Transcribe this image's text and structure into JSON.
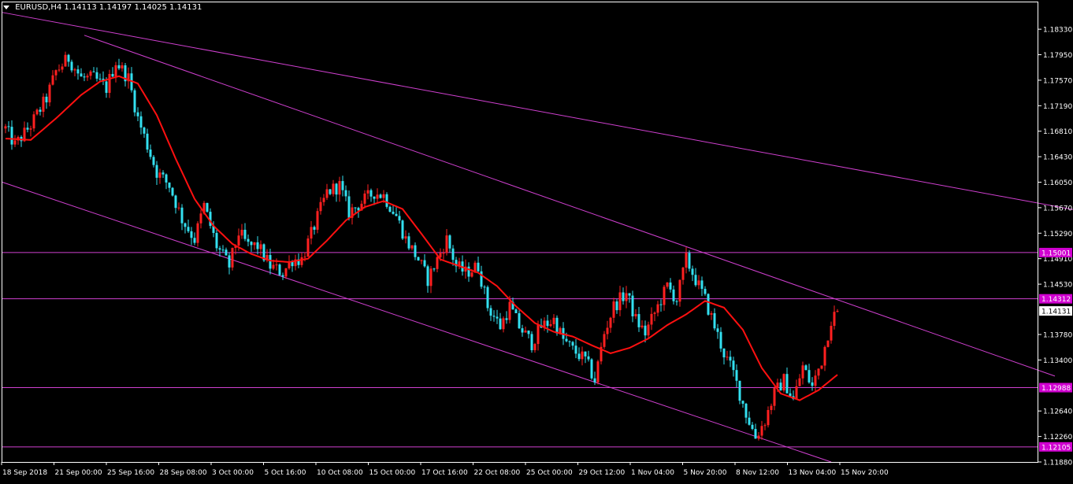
{
  "header": {
    "symbol": "EURUSD,H4",
    "ohlc": "1.14113 1.14197 1.14025 1.14131"
  },
  "colors": {
    "background": "#000000",
    "axis": "#ffffff",
    "bull_candle": "#ff2020",
    "bear_candle": "#33e0f0",
    "moving_average": "#ff1010",
    "lines": "#d040d0",
    "label_bg": "#d000d0",
    "price_label_bg": "#ffffff"
  },
  "chart_data": {
    "type": "candlestick",
    "symbol": "EURUSD",
    "timeframe": "H4",
    "ylim": [
      1.1188,
      1.1866
    ],
    "y_ticks": [
      1.1833,
      1.1795,
      1.1757,
      1.1719,
      1.1681,
      1.1643,
      1.1605,
      1.1567,
      1.1529,
      1.1491,
      1.1453,
      1.1378,
      1.134,
      1.1264,
      1.1226,
      1.1188
    ],
    "y_tick_labels": [
      "1.18330",
      "1.17950",
      "1.17570",
      "1.17190",
      "1.16810",
      "1.16430",
      "1.16050",
      "1.15670",
      "1.15290",
      "1.14910",
      "1.14530",
      "1.13780",
      "1.13400",
      "1.12640",
      "1.12260",
      "1.11880"
    ],
    "x_tick_labels": [
      "18 Sep 2018",
      "21 Sep 00:00",
      "25 Sep 16:00",
      "28 Sep 08:00",
      "3 Oct 00:00",
      "5 Oct 16:00",
      "10 Oct 08:00",
      "15 Oct 00:00",
      "17 Oct 16:00",
      "22 Oct 08:00",
      "25 Oct 00:00",
      "29 Oct 12:00",
      "1 Nov 04:00",
      "5 Nov 20:00",
      "8 Nov 12:00",
      "13 Nov 04:00",
      "15 Nov 20:00"
    ],
    "price_path": [
      [
        0,
        1.1685
      ],
      [
        3,
        1.166
      ],
      [
        8,
        1.169
      ],
      [
        13,
        1.173
      ],
      [
        16,
        1.177
      ],
      [
        20,
        1.179
      ],
      [
        24,
        1.176
      ],
      [
        28,
        1.176
      ],
      [
        32,
        1.1745
      ],
      [
        35,
        1.1785
      ],
      [
        39,
        1.176
      ],
      [
        42,
        1.17
      ],
      [
        45,
        1.166
      ],
      [
        48,
        1.162
      ],
      [
        52,
        1.16
      ],
      [
        56,
        1.155
      ],
      [
        60,
        1.152
      ],
      [
        63,
        1.157
      ],
      [
        67,
        1.151
      ],
      [
        71,
        1.148
      ],
      [
        74,
        1.153
      ],
      [
        77,
        1.151
      ],
      [
        80,
        1.151
      ],
      [
        84,
        1.148
      ],
      [
        88,
        1.147
      ],
      [
        91,
        1.149
      ],
      [
        94,
        1.149
      ],
      [
        98,
        1.154
      ],
      [
        102,
        1.159
      ],
      [
        106,
        1.16
      ],
      [
        109,
        1.156
      ],
      [
        113,
        1.1575
      ],
      [
        117,
        1.159
      ],
      [
        120,
        1.1585
      ],
      [
        124,
        1.1555
      ],
      [
        127,
        1.152
      ],
      [
        131,
        1.149
      ],
      [
        134,
        1.146
      ],
      [
        138,
        1.15
      ],
      [
        140,
        1.152
      ],
      [
        143,
        1.148
      ],
      [
        146,
        1.147
      ],
      [
        150,
        1.148
      ],
      [
        153,
        1.142
      ],
      [
        157,
        1.139
      ],
      [
        160,
        1.142
      ],
      [
        163,
        1.139
      ],
      [
        167,
        1.1365
      ],
      [
        170,
        1.139
      ],
      [
        174,
        1.14
      ],
      [
        177,
        1.137
      ],
      [
        180,
        1.1355
      ],
      [
        184,
        1.134
      ],
      [
        187,
        1.131
      ],
      [
        190,
        1.138
      ],
      [
        193,
        1.142
      ],
      [
        197,
        1.144
      ],
      [
        200,
        1.14
      ],
      [
        203,
        1.138
      ],
      [
        207,
        1.142
      ],
      [
        210,
        1.145
      ],
      [
        213,
        1.143
      ],
      [
        216,
        1.149
      ],
      [
        219,
        1.146
      ],
      [
        222,
        1.143
      ],
      [
        225,
        1.139
      ],
      [
        228,
        1.135
      ],
      [
        231,
        1.132
      ],
      [
        235,
        1.126
      ],
      [
        238,
        1.1225
      ],
      [
        241,
        1.125
      ],
      [
        244,
        1.129
      ],
      [
        247,
        1.131
      ],
      [
        250,
        1.128
      ],
      [
        253,
        1.133
      ],
      [
        256,
        1.13
      ],
      [
        259,
        1.134
      ],
      [
        262,
        1.14
      ],
      [
        264,
        1.1413
      ]
    ],
    "moving_average_path": [
      [
        0,
        1.167
      ],
      [
        8,
        1.1668
      ],
      [
        16,
        1.17
      ],
      [
        24,
        1.1735
      ],
      [
        30,
        1.1755
      ],
      [
        36,
        1.1763
      ],
      [
        42,
        1.1752
      ],
      [
        48,
        1.1705
      ],
      [
        54,
        1.164
      ],
      [
        60,
        1.158
      ],
      [
        66,
        1.154
      ],
      [
        72,
        1.1513
      ],
      [
        78,
        1.1498
      ],
      [
        84,
        1.1488
      ],
      [
        90,
        1.1486
      ],
      [
        96,
        1.1491
      ],
      [
        102,
        1.1518
      ],
      [
        108,
        1.1548
      ],
      [
        114,
        1.1568
      ],
      [
        120,
        1.1577
      ],
      [
        126,
        1.1565
      ],
      [
        132,
        1.1528
      ],
      [
        138,
        1.149
      ],
      [
        144,
        1.148
      ],
      [
        150,
        1.147
      ],
      [
        156,
        1.145
      ],
      [
        162,
        1.142
      ],
      [
        168,
        1.1395
      ],
      [
        174,
        1.1382
      ],
      [
        180,
        1.1375
      ],
      [
        186,
        1.1362
      ],
      [
        192,
        1.135
      ],
      [
        198,
        1.1358
      ],
      [
        204,
        1.1372
      ],
      [
        210,
        1.1392
      ],
      [
        216,
        1.1408
      ],
      [
        222,
        1.1428
      ],
      [
        228,
        1.1418
      ],
      [
        234,
        1.1385
      ],
      [
        240,
        1.1328
      ],
      [
        246,
        1.129
      ],
      [
        252,
        1.128
      ],
      [
        258,
        1.1295
      ],
      [
        264,
        1.1318
      ]
    ],
    "horizontal_levels": [
      {
        "price": 1.15001,
        "label": "1.15001"
      },
      {
        "price": 1.14312,
        "label": "1.14312"
      },
      {
        "price": 1.12988,
        "label": "1.12988"
      },
      {
        "price": 1.12105,
        "label": "1.12105"
      }
    ],
    "trendlines": [
      {
        "from": [
          -1,
          1.1858
        ],
        "to": [
          346,
          1.1558
        ]
      },
      {
        "from": [
          25,
          1.1824
        ],
        "to": [
          333,
          1.1316
        ]
      },
      {
        "from": [
          -1,
          1.1605
        ],
        "to": [
          262,
          1.1188
        ]
      }
    ],
    "current_price": {
      "price": 1.14131,
      "label": "1.14131"
    }
  }
}
